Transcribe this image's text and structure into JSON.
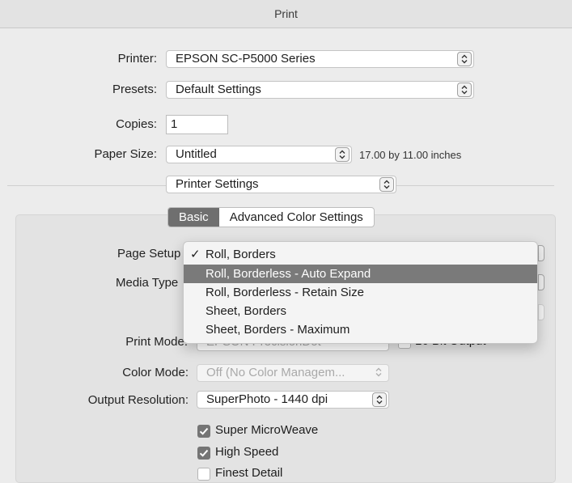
{
  "window": {
    "title": "Print"
  },
  "printer": {
    "label": "Printer:",
    "value": "EPSON SC-P5000 Series"
  },
  "presets": {
    "label": "Presets:",
    "value": "Default Settings"
  },
  "copies": {
    "label": "Copies:",
    "value": "1"
  },
  "paper_size": {
    "label": "Paper Size:",
    "value": "Untitled",
    "dimensions": "17.00 by 11.00 inches"
  },
  "panel_select": {
    "value": "Printer Settings"
  },
  "tabs": [
    {
      "label": "Basic",
      "selected": true
    },
    {
      "label": "Advanced Color Settings",
      "selected": false
    }
  ],
  "page_setup": {
    "label": "Page Setup"
  },
  "media_type": {
    "label": "Media Type"
  },
  "page_setup_menu": {
    "items": [
      {
        "label": "Roll, Borders",
        "checked": true
      },
      {
        "label": "Roll, Borderless - Auto Expand",
        "highlighted": true
      },
      {
        "label": "Roll, Borderless - Retain Size"
      },
      {
        "label": "Sheet, Borders"
      },
      {
        "label": "Sheet, Borders - Maximum"
      }
    ],
    "check_glyph": "✓"
  },
  "print_mode": {
    "label": "Print Mode:",
    "value": "EPSON PrecisionDot",
    "sixteen_bit_label": "16 Bit Output"
  },
  "color_mode": {
    "label": "Color Mode:",
    "value": "Off (No Color Managem..."
  },
  "output_resolution": {
    "label": "Output Resolution:",
    "value": "SuperPhoto - 1440 dpi"
  },
  "options": [
    {
      "label": "Super MicroWeave",
      "checked": true
    },
    {
      "label": "High Speed",
      "checked": true
    },
    {
      "label": "Finest Detail",
      "checked": false
    }
  ],
  "colors": {
    "highlight": "#7a7a7a",
    "checkbox_on": "#757575"
  }
}
